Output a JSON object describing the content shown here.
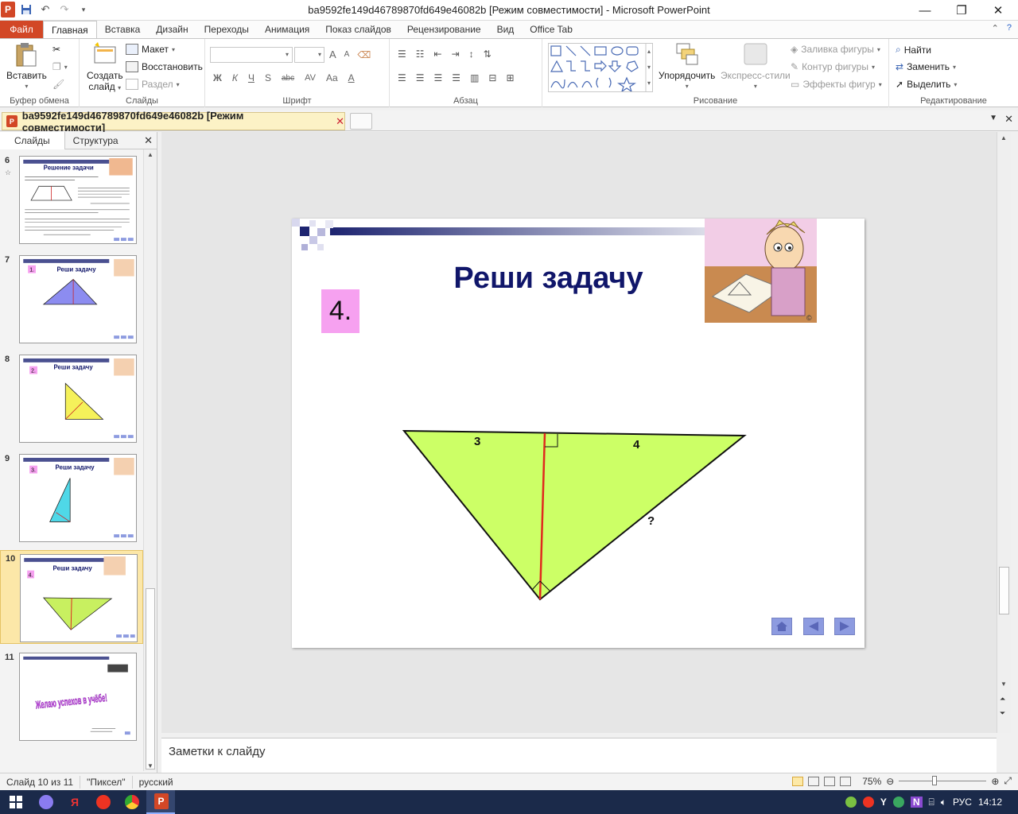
{
  "window": {
    "title": "ba9592fe149d46789870fd649e46082b [Режим совместимости]  -  Microsoft PowerPoint",
    "app_letter": "P"
  },
  "ribbon_tabs": {
    "file": "Файл",
    "tabs": [
      "Главная",
      "Вставка",
      "Дизайн",
      "Переходы",
      "Анимация",
      "Показ слайдов",
      "Рецензирование",
      "Вид",
      "Office Tab"
    ],
    "active_index": 0
  },
  "ribbon": {
    "clipboard": {
      "label": "Буфер обмена",
      "paste": "Вставить"
    },
    "slides": {
      "label": "Слайды",
      "create_line1": "Создать",
      "create_line2": "слайд",
      "layout": "Макет",
      "reset": "Восстановить",
      "section": "Раздел"
    },
    "font": {
      "label": "Шрифт",
      "bold": "Ж",
      "italic": "К",
      "underline": "Ч",
      "strike": "abc",
      "shadow": "S",
      "spacing": "AV",
      "case": "Aa",
      "grow": "A",
      "shrink": "A",
      "color": "A"
    },
    "paragraph": {
      "label": "Абзац"
    },
    "drawing": {
      "label": "Рисование",
      "arrange": "Упорядочить",
      "quick_styles": "Экспресс-стили",
      "fill": "Заливка фигуры",
      "outline": "Контур фигуры",
      "effects": "Эффекты фигур"
    },
    "editing": {
      "label": "Редактирование",
      "find": "Найти",
      "replace": "Заменить",
      "select": "Выделить"
    }
  },
  "doc_tab": {
    "title": "ba9592fe149d46789870fd649e46082b [Режим совместимости]",
    "close": "✕"
  },
  "left_pane": {
    "tabs": [
      "Слайды",
      "Структура"
    ],
    "close": "✕",
    "thumbnails": [
      {
        "num": "6",
        "title": "Решение задачи",
        "selected": false
      },
      {
        "num": "7",
        "title": "Реши задачу",
        "badge": "1.",
        "tri_color": "#8c8cf0",
        "selected": false
      },
      {
        "num": "8",
        "title": "Реши задачу",
        "badge": "2.",
        "tri_color": "#f5f15a",
        "selected": false
      },
      {
        "num": "9",
        "title": "Реши задачу",
        "badge": "3.",
        "tri_color": "#4fd8e8",
        "selected": false
      },
      {
        "num": "10",
        "title": "Реши задачу",
        "badge": "4.",
        "tri_color": "#c8f060",
        "selected": true
      },
      {
        "num": "11",
        "wordart": "Желаю успехов в учёбе!",
        "selected": false
      }
    ]
  },
  "slide": {
    "title": "Реши задачу",
    "number_badge": "4.",
    "label_a": "3",
    "label_b": "4",
    "label_q": "?",
    "triangle_fill": "#ccff66",
    "altitude_color": "#e0291e",
    "title_color": "#10166a"
  },
  "notes": {
    "placeholder": "Заметки к слайду"
  },
  "status": {
    "slide_info": "Слайд 10 из 11",
    "theme": "\"Пиксел\"",
    "language": "русский",
    "zoom": "75%"
  },
  "taskbar": {
    "lang": "РУС",
    "time": "14:12"
  }
}
